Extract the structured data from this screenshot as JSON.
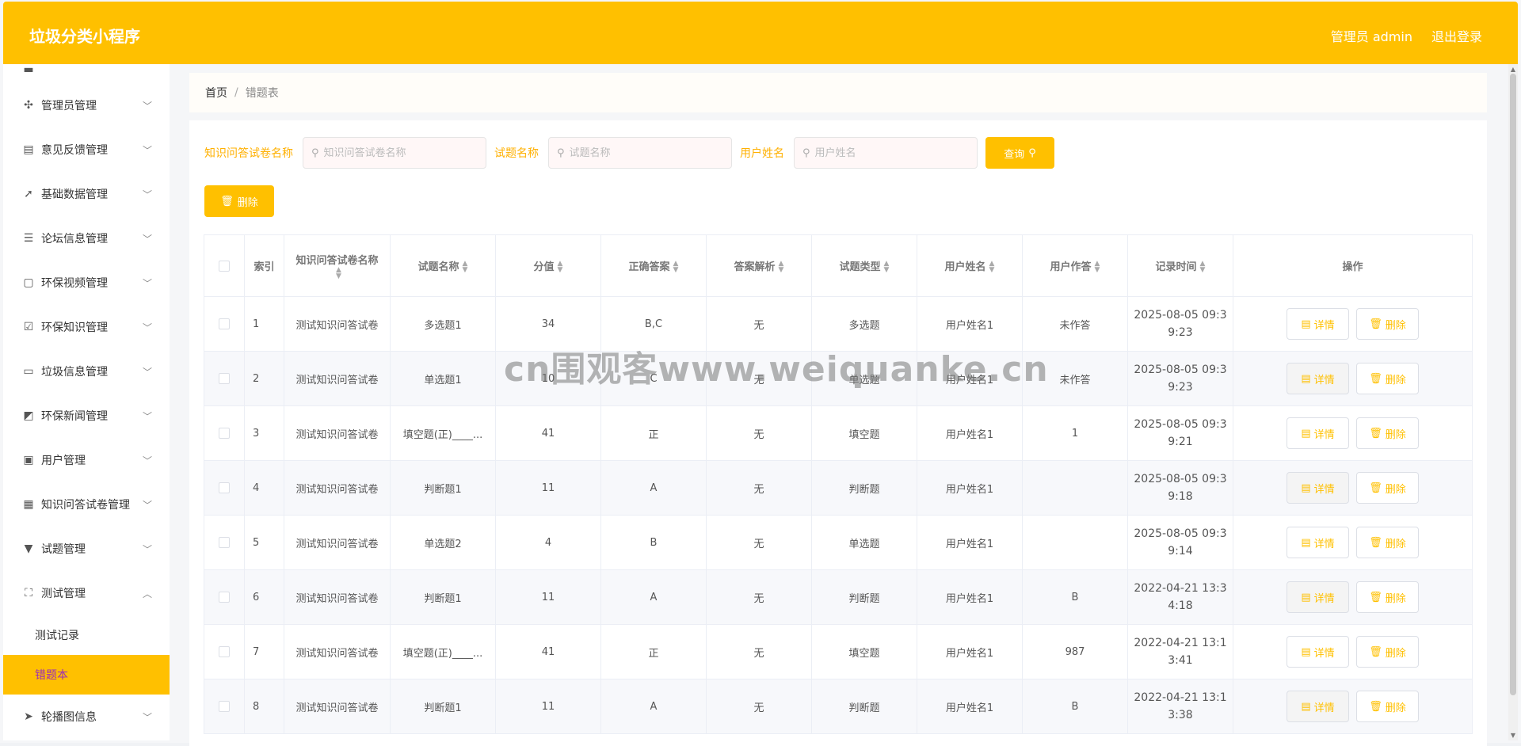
{
  "header": {
    "brand": "垃圾分类小程序",
    "admin_label": "管理员 admin",
    "logout_label": "退出登录",
    "accent_color": "#ffc000"
  },
  "sidebar": {
    "items": [
      {
        "label": "管理员管理",
        "icon": "gear-icon"
      },
      {
        "label": "意见反馈管理",
        "icon": "clipboard-icon"
      },
      {
        "label": "基础数据管理",
        "icon": "send-icon"
      },
      {
        "label": "论坛信息管理",
        "icon": "list-icon"
      },
      {
        "label": "环保视频管理",
        "icon": "chat-icon"
      },
      {
        "label": "环保知识管理",
        "icon": "checklist-icon"
      },
      {
        "label": "垃圾信息管理",
        "icon": "monitor-icon"
      },
      {
        "label": "环保新闻管理",
        "icon": "chart-icon"
      },
      {
        "label": "用户管理",
        "icon": "id-card-icon"
      },
      {
        "label": "知识问答试卷管理",
        "icon": "grid-icon"
      },
      {
        "label": "试题管理",
        "icon": "brush-icon"
      },
      {
        "label": "测试管理",
        "icon": "fullscreen-icon"
      }
    ],
    "sub_items": [
      {
        "label": "测试记录"
      },
      {
        "label": "错题本"
      }
    ],
    "last_item": {
      "label": "轮播图信息",
      "icon": "paper-plane-icon"
    }
  },
  "breadcrumb": {
    "home": "首页",
    "separator": "/",
    "current": "错题表"
  },
  "search": {
    "paper_label": "知识问答试卷名称",
    "paper_placeholder": "知识问答试卷名称",
    "question_label": "试题名称",
    "question_placeholder": "试题名称",
    "user_label": "用户姓名",
    "user_placeholder": "用户姓名",
    "query_button": "查询"
  },
  "toolbar": {
    "delete_button": "删除"
  },
  "table": {
    "headers": {
      "index": "索引",
      "paper": "知识问答试卷名称",
      "question": "试题名称",
      "score": "分值",
      "answer": "正确答案",
      "analysis": "答案解析",
      "type": "试题类型",
      "user": "用户姓名",
      "user_answer": "用户作答",
      "time": "记录时间",
      "ops": "操作"
    },
    "detail_label": "详情",
    "delete_label": "删除",
    "rows": [
      {
        "index": "1",
        "paper": "测试知识问答试卷",
        "question": "多选题1",
        "score": "34",
        "answer": "B,C",
        "analysis": "无",
        "type": "多选题",
        "user": "用户姓名1",
        "user_answer": "未作答",
        "time1": "2025-08-05 09:3",
        "time2": "9:23"
      },
      {
        "index": "2",
        "paper": "测试知识问答试卷",
        "question": "单选题1",
        "score": "10",
        "answer": "C",
        "analysis": "无",
        "type": "单选题",
        "user": "用户姓名1",
        "user_answer": "未作答",
        "time1": "2025-08-05 09:3",
        "time2": "9:23"
      },
      {
        "index": "3",
        "paper": "测试知识问答试卷",
        "question": "填空题(正)____...",
        "score": "41",
        "answer": "正",
        "analysis": "无",
        "type": "填空题",
        "user": "用户姓名1",
        "user_answer": "1",
        "time1": "2025-08-05 09:3",
        "time2": "9:21"
      },
      {
        "index": "4",
        "paper": "测试知识问答试卷",
        "question": "判断题1",
        "score": "11",
        "answer": "A",
        "analysis": "无",
        "type": "判断题",
        "user": "用户姓名1",
        "user_answer": "",
        "time1": "2025-08-05 09:3",
        "time2": "9:18"
      },
      {
        "index": "5",
        "paper": "测试知识问答试卷",
        "question": "单选题2",
        "score": "4",
        "answer": "B",
        "analysis": "无",
        "type": "单选题",
        "user": "用户姓名1",
        "user_answer": "",
        "time1": "2025-08-05 09:3",
        "time2": "9:14"
      },
      {
        "index": "6",
        "paper": "测试知识问答试卷",
        "question": "判断题1",
        "score": "11",
        "answer": "A",
        "analysis": "无",
        "type": "判断题",
        "user": "用户姓名1",
        "user_answer": "B",
        "time1": "2022-04-21 13:3",
        "time2": "4:18"
      },
      {
        "index": "7",
        "paper": "测试知识问答试卷",
        "question": "填空题(正)____...",
        "score": "41",
        "answer": "正",
        "analysis": "无",
        "type": "填空题",
        "user": "用户姓名1",
        "user_answer": "987",
        "time1": "2022-04-21 13:1",
        "time2": "3:41"
      },
      {
        "index": "8",
        "paper": "测试知识问答试卷",
        "question": "判断题1",
        "score": "11",
        "answer": "A",
        "analysis": "无",
        "type": "判断题",
        "user": "用户姓名1",
        "user_answer": "B",
        "time1": "2022-04-21 13:1",
        "time2": "3:38"
      }
    ]
  },
  "watermark": "cn围观客www.weiquanke.cn"
}
